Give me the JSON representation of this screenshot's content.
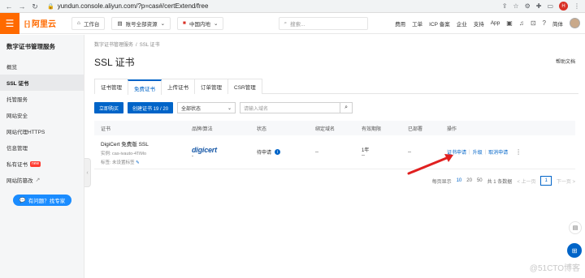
{
  "browser": {
    "url": "yundun.console.aliyun.com/?p=cas#/certExtend/free",
    "profile": "H"
  },
  "topnav": {
    "brand": "阿里云",
    "workbench": "工作台",
    "account": "账号全部资源",
    "region": "中国内地",
    "search_placeholder": "搜索...",
    "links": [
      "费用",
      "工单",
      "ICP 备案",
      "企业",
      "支持",
      "App"
    ],
    "lang": "简体"
  },
  "sidebar": {
    "title": "数字证书管理服务",
    "items": [
      {
        "label": "概览"
      },
      {
        "label": "SSL 证书"
      },
      {
        "label": "托管服务"
      },
      {
        "label": "网站安全"
      },
      {
        "label": "网站代理HTTPS"
      },
      {
        "label": "信息管理"
      },
      {
        "label": "私有证书",
        "badge": "new"
      },
      {
        "label": "网站防篡改"
      }
    ],
    "help_button": "有问题？找专家"
  },
  "main": {
    "breadcrumb": [
      "数字证书管理服务",
      "SSL 证书"
    ],
    "title": "SSL 证书",
    "help_doc": "帮助文档",
    "tabs": [
      "证书管理",
      "免费证书",
      "上传证书",
      "订单管理",
      "CSR管理"
    ],
    "toolbar": {
      "buy": "立即购买",
      "create": "创建证书 19 / 20",
      "status_select": "全部状态",
      "domain_placeholder": "请输入域名"
    },
    "table": {
      "headers": [
        "证书",
        "品牌/算法",
        "状态",
        "绑定域名",
        "有效期限",
        "已部署",
        "操作"
      ],
      "rows": [
        {
          "name": "DigiCert 免费版 SSL",
          "instance": "实例: cas-ivauto-4TiMo",
          "tag": "标签: 未设置标签",
          "brand": "digicert",
          "brand_sub": "-",
          "status": "待申请",
          "domain": "--",
          "validity": "1年",
          "validity_sub": "--",
          "deployed": "--",
          "ops": [
            "证书申请",
            "升级",
            "取消申请"
          ]
        }
      ]
    },
    "pagination": {
      "page_size_label": "每页显示",
      "sizes": [
        "10",
        "20",
        "50"
      ],
      "total": "共 1 条数据",
      "prev": "< 上一页",
      "current": "1",
      "next": "下一页 >"
    }
  },
  "watermark": "@51CTO博客",
  "colors": {
    "brand": "#ff6a00",
    "primary": "#0064c8",
    "arrow": "#e02020"
  }
}
